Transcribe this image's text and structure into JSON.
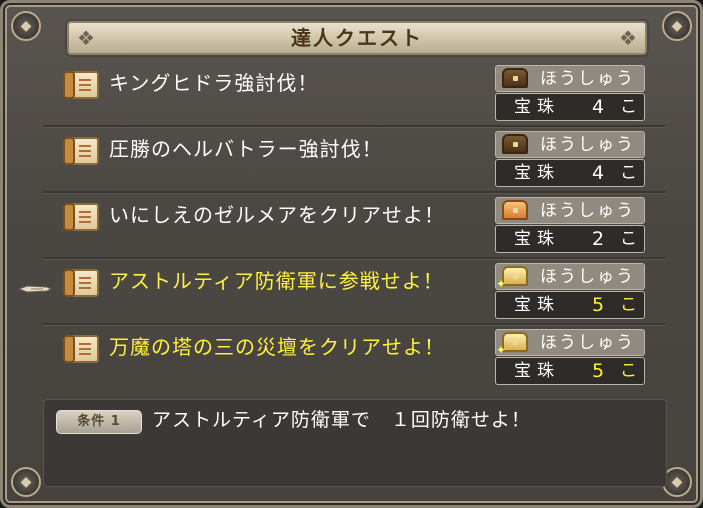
{
  "window": {
    "title": "達人クエスト"
  },
  "quests": [
    {
      "name": "キングヒドラ強討伐！",
      "highlight": false,
      "chest": "dark",
      "reward_label": "ほうしゅう",
      "reward_item": "宝珠",
      "reward_count": "4",
      "reward_unit": "こ"
    },
    {
      "name": "圧勝のヘルバトラー強討伐！",
      "highlight": false,
      "chest": "dark",
      "reward_label": "ほうしゅう",
      "reward_item": "宝珠",
      "reward_count": "4",
      "reward_unit": "こ"
    },
    {
      "name": "いにしえのゼルメアをクリアせよ！",
      "highlight": false,
      "chest": "open",
      "reward_label": "ほうしゅう",
      "reward_item": "宝珠",
      "reward_count": "2",
      "reward_unit": "こ"
    },
    {
      "name": "アストルティア防衛軍に参戦せよ！",
      "highlight": true,
      "chest": "gold",
      "reward_label": "ほうしゅう",
      "reward_item": "宝珠",
      "reward_count": "5",
      "reward_unit": "こ"
    },
    {
      "name": "万魔の塔の三の災壇をクリアせよ！",
      "highlight": true,
      "chest": "gold",
      "reward_label": "ほうしゅう",
      "reward_item": "宝珠",
      "reward_count": "5",
      "reward_unit": "こ"
    }
  ],
  "selected_quest_index": 3,
  "condition": {
    "badge": "条件 1",
    "text": "アストルティア防衛軍で　１回防衛せよ！"
  },
  "colors": {
    "highlight_text": "#fff23a",
    "normal_text": "#ffffff",
    "title_text": "#4a3516"
  },
  "icons": {
    "quest": "scroll-icon",
    "reward": "treasure-chest-icon",
    "cursor": "pointing-hand-cursor-icon"
  }
}
